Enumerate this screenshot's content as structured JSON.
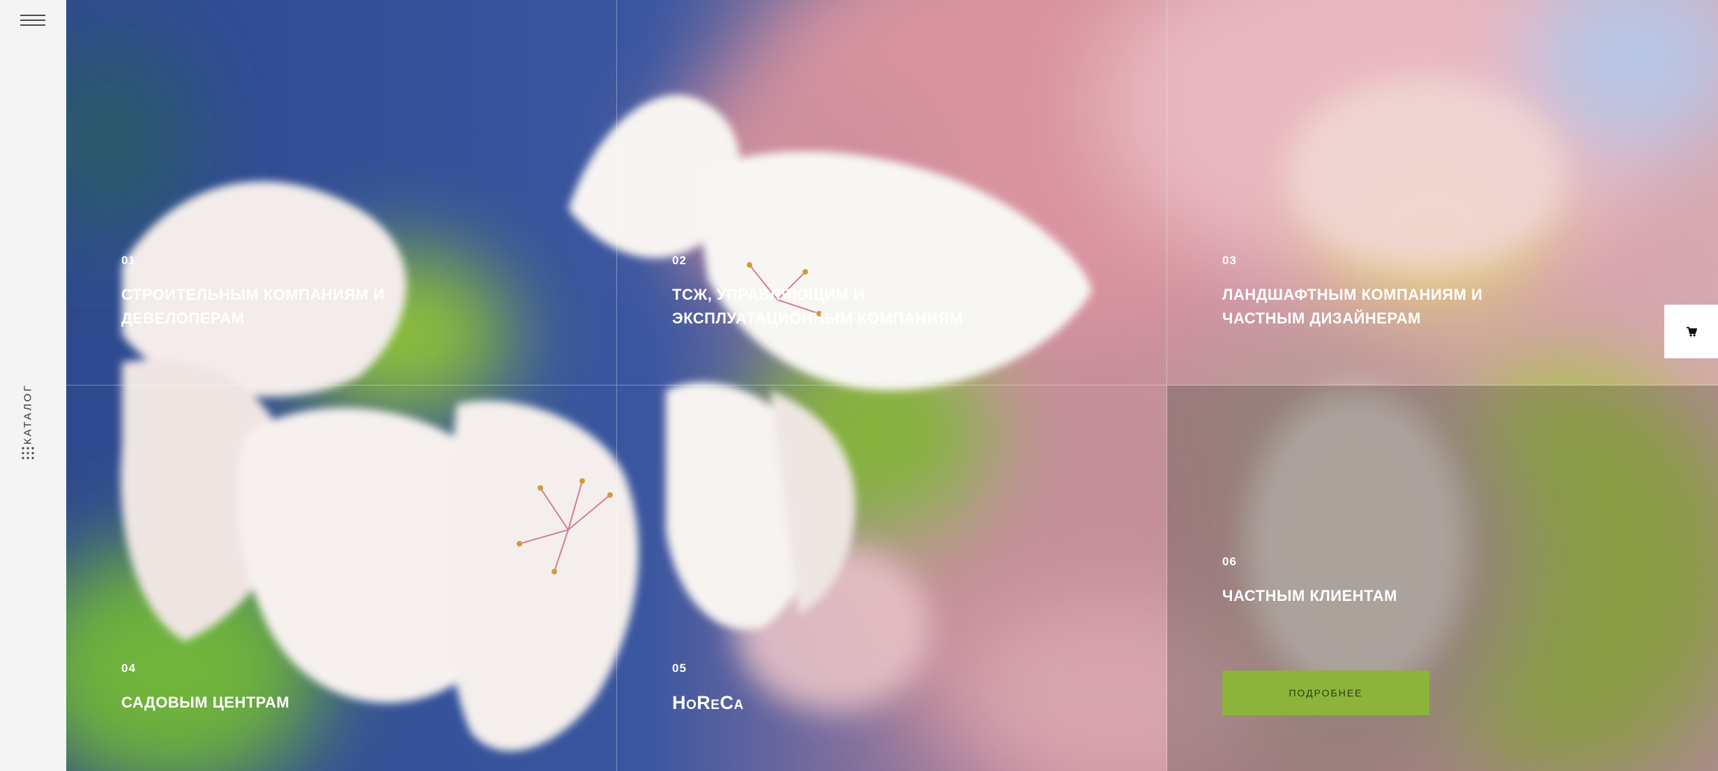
{
  "sidebar": {
    "menu_icon": "hamburger-icon",
    "catalog_label": "КАТАЛОГ",
    "catalog_icon": "grid-dots-icon"
  },
  "tiles": [
    {
      "num": "01",
      "title": "СТРОИТЕЛЬНЫМ КОМПАНИЯМ И ДЕВЕЛОПЕРАМ"
    },
    {
      "num": "02",
      "title": "ТСЖ, УПРАВЛЯЮЩИМ И ЭКСПЛУАТАЦИОННЫМ КОМПАНИЯМ"
    },
    {
      "num": "03",
      "title": "ЛАНДШАФТНЫМ КОМПАНИЯМ И ЧАСТНЫМ ДИЗАЙНЕРАМ"
    },
    {
      "num": "04",
      "title": "САДОВЫМ ЦЕНТРАМ"
    },
    {
      "num": "05",
      "title": "HoReCa"
    },
    {
      "num": "06",
      "title": "ЧАСТНЫМ КЛИЕНТАМ"
    }
  ],
  "more_button": "ПОДРОБНЕЕ",
  "cart_icon": "cart-icon",
  "colors": {
    "accent": "#8db43a",
    "sidebar": "#f4f4f4"
  }
}
